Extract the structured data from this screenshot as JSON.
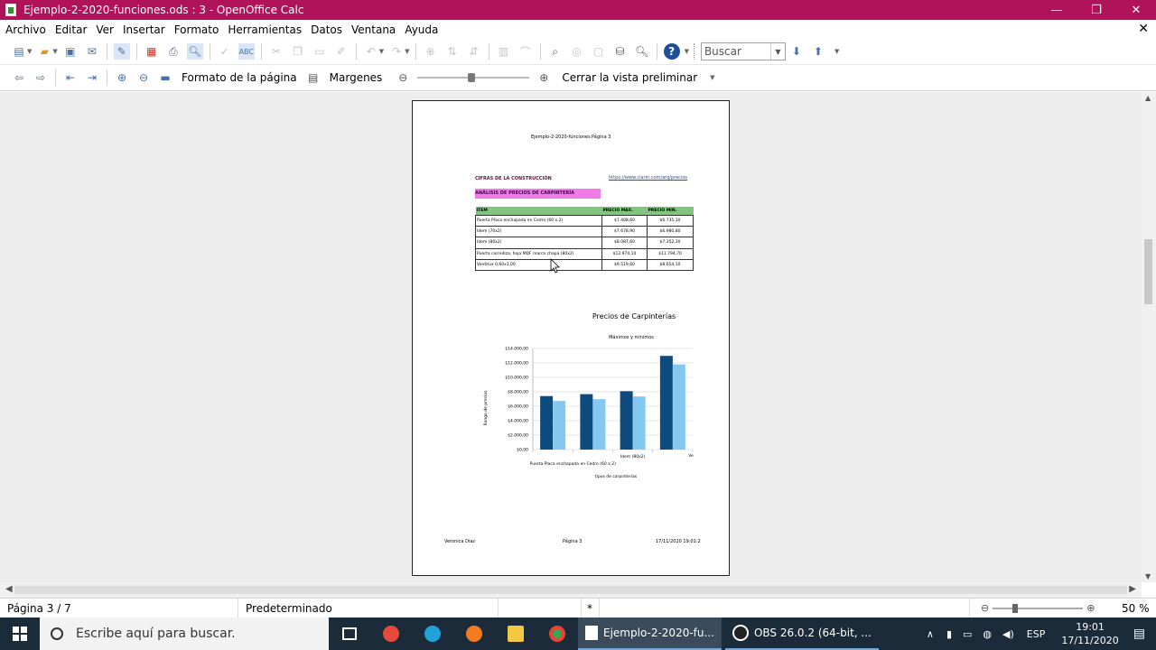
{
  "window": {
    "title": "Ejemplo-2-2020-funciones.ods : 3 - OpenOffice Calc",
    "min": "—",
    "restore": "❐",
    "close": "✕"
  },
  "menu": [
    "Archivo",
    "Editar",
    "Ver",
    "Insertar",
    "Formato",
    "Herramientas",
    "Datos",
    "Ventana",
    "Ayuda"
  ],
  "toolbar": {
    "search_placeholder": "Buscar"
  },
  "preview_toolbar": {
    "page_format": "Formato de la página",
    "margins": "Margenes",
    "close_preview": "Cerrar la vista preliminar"
  },
  "page": {
    "header": "Ejemplo-2-2020-funciones",
    "header_page": "Página 3",
    "heading1": "CIFRAS DE LA CONSTRUCCIÓN",
    "link": "https://www.clarin.com/arq/precios",
    "heading2": "ANÁLISIS DE PRECIOS DE CARPINTERÍA",
    "table": {
      "headers": [
        "ITEM",
        "PRECIO MAX.",
        "PRECIO MIN."
      ],
      "rows": [
        [
          "Puerta Placa enchapada en Cedro (60 x 2)",
          "$7.408,60",
          "$6.735,10"
        ],
        [
          "Idem (70x2)",
          "$7.678,90",
          "$6.980,80"
        ],
        [
          "Idem (80x2)",
          "$8.087,60",
          "$7.352,30"
        ],
        [
          "Puerta corrediza, hoja MDF marco chapa (80x2)",
          "$12.974,10",
          "$11.794,70"
        ],
        [
          "Ventitux 0,60x1,00",
          "$9.519,60",
          "$8.654,10"
        ]
      ]
    },
    "footer": {
      "left": "Veronica Diaz",
      "center": "Página 3",
      "right": "17/11/2020 19:01:2"
    }
  },
  "chart_data": {
    "type": "bar",
    "title": "Precios de Carpinterías",
    "subtitle": "Máximos y mínimos",
    "xlabel": "tipos de carpinterías",
    "ylabel": "Rango de precios",
    "ylim": [
      0,
      14000
    ],
    "yticks": [
      "$0,00",
      "$2.000,00",
      "$4.000,00",
      "$6.000,00",
      "$8.000,00",
      "$10.000,00",
      "$12.000,00",
      "$14.000,00"
    ],
    "category_labels": [
      "Puerta Placa enchapada en Cedro (60 x 2)",
      "Idem (80x2)",
      "Ve"
    ],
    "categories": [
      "Puerta Placa enchapada en Cedro (60 x 2)",
      "Idem (70x2)",
      "Idem (80x2)",
      "Puerta corrediza, hoja MDF marco chapa (80x2)"
    ],
    "series": [
      {
        "values": [
          7408.6,
          7678.9,
          8087.6,
          12974.1
        ],
        "color": "#0d4a7e"
      },
      {
        "values": [
          6735.1,
          6980.8,
          7352.3,
          11794.7
        ],
        "color": "#84c8f2"
      }
    ],
    "grid": true
  },
  "status": {
    "page": "Página 3 / 7",
    "style": "Predeterminado",
    "modified": "*",
    "zoom": "50 %"
  },
  "taskbar": {
    "search": "Escribe aquí para buscar.",
    "task1": "Ejemplo-2-2020-fu...",
    "task2": "OBS 26.0.2 (64-bit, ...",
    "lang": "ESP",
    "time": "19:01",
    "date": "17/11/2020"
  }
}
